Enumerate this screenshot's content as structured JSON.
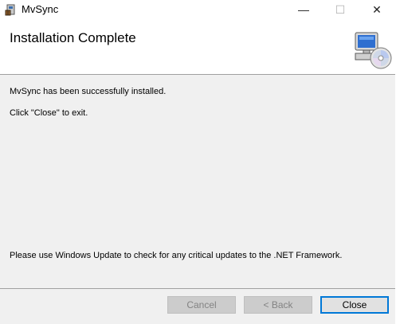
{
  "window": {
    "title": "MvSync",
    "icon": "installer-icon",
    "controls": {
      "minimize": "—",
      "maximize": "☐",
      "close": "✕"
    }
  },
  "header": {
    "title": "Installation Complete",
    "icon": "computer-cd-icon"
  },
  "content": {
    "line1": "MvSync has been successfully installed.",
    "line2": "Click \"Close\" to exit.",
    "line3": "Please use Windows Update to check for any critical updates to the .NET Framework."
  },
  "buttons": {
    "cancel": "Cancel",
    "back": "< Back",
    "close": "Close"
  }
}
